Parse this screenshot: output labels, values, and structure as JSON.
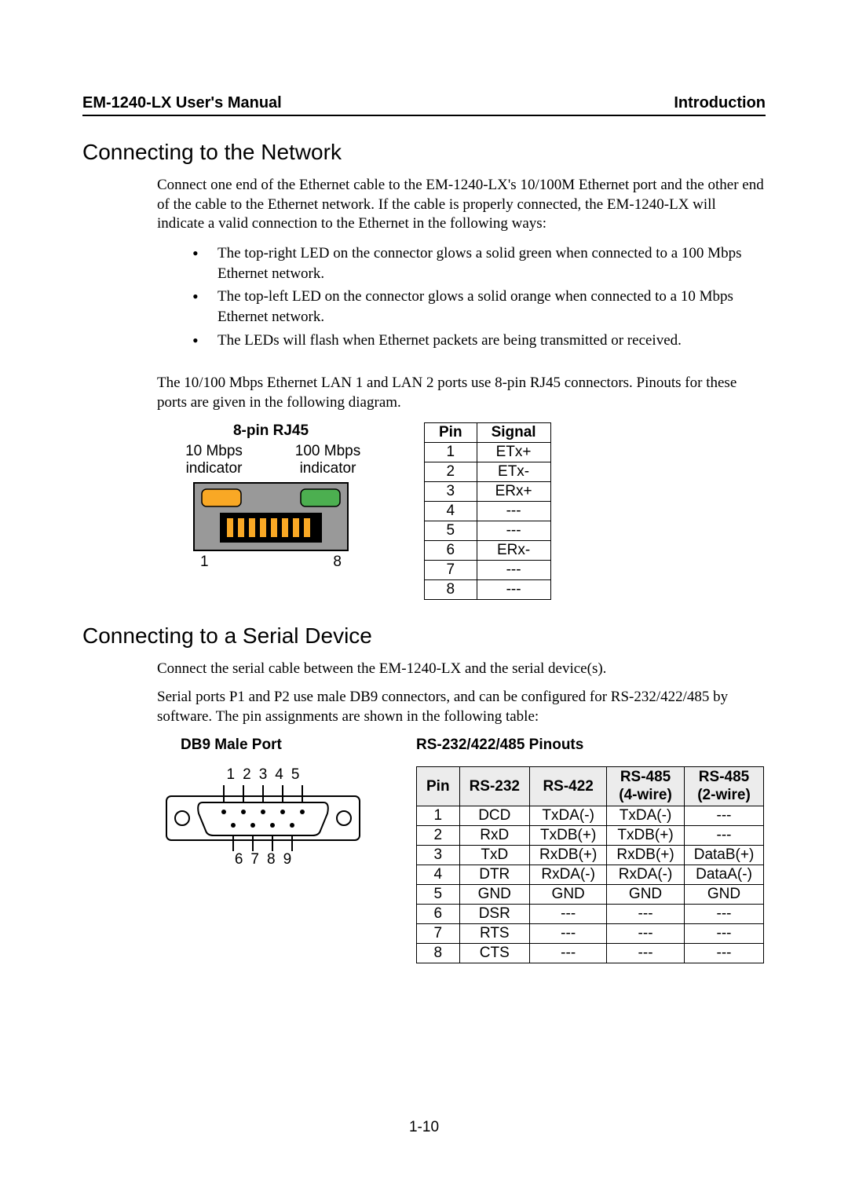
{
  "header": {
    "left": "EM-1240-LX User's Manual",
    "right": "Introduction"
  },
  "section1": {
    "heading": "Connecting to the Network",
    "para1": "Connect one end of the Ethernet cable to the EM-1240-LX's 10/100M Ethernet port and the other end of the cable to the Ethernet network. If the cable is properly connected, the EM-1240-LX will indicate a valid connection to the Ethernet in the following ways:",
    "bullets": [
      "The top-right LED on the connector glows a solid green when connected to a 100 Mbps Ethernet network.",
      "The top-left LED on the connector glows a solid orange when connected to a 10 Mbps Ethernet network.",
      "The LEDs will flash when Ethernet packets are being transmitted or received."
    ],
    "para2": "The 10/100 Mbps Ethernet LAN 1 and LAN 2 ports use 8-pin RJ45 connectors. Pinouts for these ports are given in the following diagram.",
    "rj45": {
      "title": "8-pin RJ45",
      "label_left_a": "10 Mbps",
      "label_left_b": "indicator",
      "label_right_a": "100 Mbps",
      "label_right_b": "indicator",
      "num_left": "1",
      "num_right": "8"
    },
    "rj45_table": {
      "head_pin": "Pin",
      "head_signal": "Signal",
      "rows": [
        {
          "pin": "1",
          "signal": "ETx+"
        },
        {
          "pin": "2",
          "signal": "ETx-"
        },
        {
          "pin": "3",
          "signal": "ERx+"
        },
        {
          "pin": "4",
          "signal": "---"
        },
        {
          "pin": "5",
          "signal": "---"
        },
        {
          "pin": "6",
          "signal": "ERx-"
        },
        {
          "pin": "7",
          "signal": "---"
        },
        {
          "pin": "8",
          "signal": "---"
        }
      ]
    }
  },
  "section2": {
    "heading": "Connecting to a Serial Device",
    "para1": "Connect the serial cable between the EM-1240-LX and the serial device(s).",
    "para2": "Serial ports P1 and P2 use male DB9 connectors, and can be configured for RS-232/422/485 by software. The pin assignments are shown in the following table:",
    "db9_title": "DB9 Male Port",
    "db9_top_nums": [
      "1",
      "2",
      "3",
      "4",
      "5"
    ],
    "db9_bottom_nums": [
      "6",
      "7",
      "8",
      "9"
    ],
    "pinout_title": "RS-232/422/485 Pinouts",
    "table": {
      "head": {
        "pin": "Pin",
        "rs232": "RS-232",
        "rs422": "RS-422",
        "rs485_4": "RS-485\n(4-wire)",
        "rs485_2": "RS-485\n(2-wire)"
      },
      "rows": [
        {
          "pin": "1",
          "rs232": "DCD",
          "rs422": "TxDA(-)",
          "rs485_4": "TxDA(-)",
          "rs485_2": "---"
        },
        {
          "pin": "2",
          "rs232": "RxD",
          "rs422": "TxDB(+)",
          "rs485_4": "TxDB(+)",
          "rs485_2": "---"
        },
        {
          "pin": "3",
          "rs232": "TxD",
          "rs422": "RxDB(+)",
          "rs485_4": "RxDB(+)",
          "rs485_2": "DataB(+)"
        },
        {
          "pin": "4",
          "rs232": "DTR",
          "rs422": "RxDA(-)",
          "rs485_4": "RxDA(-)",
          "rs485_2": "DataA(-)"
        },
        {
          "pin": "5",
          "rs232": "GND",
          "rs422": "GND",
          "rs485_4": "GND",
          "rs485_2": "GND"
        },
        {
          "pin": "6",
          "rs232": "DSR",
          "rs422": "---",
          "rs485_4": "---",
          "rs485_2": "---"
        },
        {
          "pin": "7",
          "rs232": "RTS",
          "rs422": "---",
          "rs485_4": "---",
          "rs485_2": "---"
        },
        {
          "pin": "8",
          "rs232": "CTS",
          "rs422": "---",
          "rs485_4": "---",
          "rs485_2": "---"
        }
      ]
    }
  },
  "page_num": "1-10"
}
